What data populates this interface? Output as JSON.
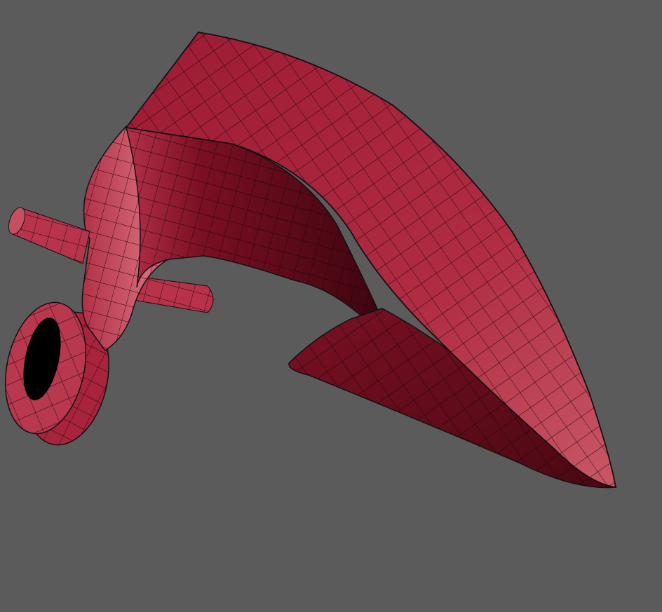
{
  "viewport": {
    "background_color": "#5b5b5b",
    "model_color": "#a81e38",
    "model_highlight_color": "#c84a5c",
    "model_shadow_color": "#4a0812",
    "wire_color": "#1a0508"
  }
}
